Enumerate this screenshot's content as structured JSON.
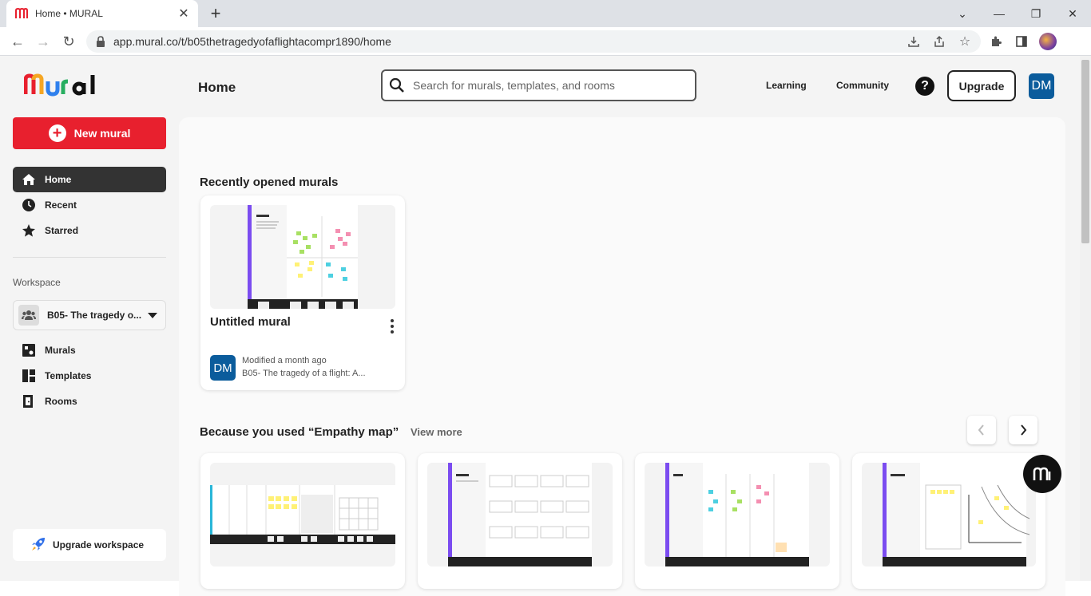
{
  "browser": {
    "tab_title": "Home • MURAL",
    "url": "app.mural.co/t/b05thetragedyofaflightacompr1890/home"
  },
  "header": {
    "search_placeholder": "Search for murals, templates, and rooms",
    "learning": "Learning",
    "community": "Community",
    "help": "?",
    "upgrade": "Upgrade",
    "avatar": "DM"
  },
  "sidebar": {
    "new_mural": "New mural",
    "items": [
      {
        "label": "Home",
        "icon": "home-icon"
      },
      {
        "label": "Recent",
        "icon": "clock-icon"
      },
      {
        "label": "Starred",
        "icon": "star-icon"
      }
    ],
    "workspace_label": "Workspace",
    "workspace_name": "B05- The tragedy o...",
    "workspace_items": [
      {
        "label": "Murals",
        "icon": "murals-icon"
      },
      {
        "label": "Templates",
        "icon": "templates-icon"
      },
      {
        "label": "Rooms",
        "icon": "rooms-icon"
      }
    ],
    "upgrade_workspace": "Upgrade workspace"
  },
  "main": {
    "title": "Home",
    "recent_title": "Recently opened murals",
    "recent_card": {
      "title": "Untitled mural",
      "avatar": "DM",
      "modified": "Modified a month ago",
      "workspace": "B05- The tragedy of a flight: A..."
    },
    "because_title": "Because you used  “Empathy map”",
    "view_more": "View more"
  },
  "colors": {
    "brand_red": "#e8202e",
    "avatar_blue": "#0b5c9c",
    "template_purple": "#7b4cf0"
  }
}
